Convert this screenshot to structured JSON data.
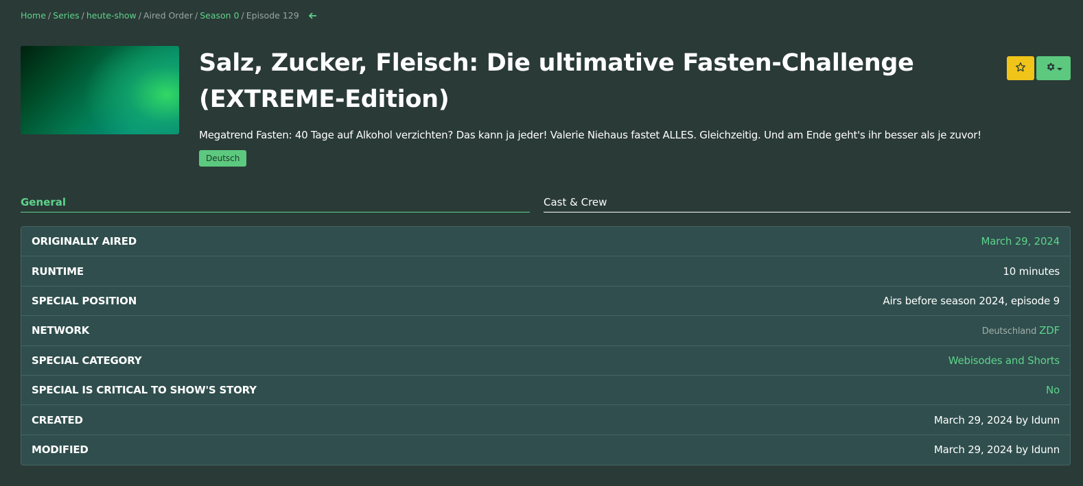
{
  "breadcrumb": {
    "home": "Home",
    "series": "Series",
    "show": "heute-show",
    "order": "Aired Order",
    "season": "Season 0",
    "episode": "Episode 129",
    "separator": "/",
    "back_icon": "arrow-left-icon"
  },
  "episode": {
    "title": "Salz, Zucker, Fleisch: Die ultimative Fasten-Challenge (EXTREME-Edition)",
    "overview": "Megatrend Fasten: 40 Tage auf Alkohol verzichten? Das kann ja jeder! Valerie Niehaus fastet ALLES. Gleichzeitig. Und am Ende geht's ihr besser als je zuvor!",
    "language": "Deutsch"
  },
  "actions": {
    "favorite_icon": "star-icon",
    "settings_icon": "gear-icon",
    "caret_icon": "caret-down-icon"
  },
  "tabs": {
    "general": "General",
    "cast": "Cast & Crew"
  },
  "info": {
    "originally_aired_label": "ORIGINALLY AIRED",
    "originally_aired_value": "March 29, 2024",
    "runtime_label": "RUNTIME",
    "runtime_value": "10 minutes",
    "special_position_label": "SPECIAL POSITION",
    "special_position_value": "Airs before season 2024, episode 9",
    "network_label": "NETWORK",
    "network_country": "Deutschland",
    "network_value": "ZDF",
    "special_category_label": "SPECIAL CATEGORY",
    "special_category_value": "Webisodes and Shorts",
    "critical_label": "SPECIAL IS CRITICAL TO SHOW'S STORY",
    "critical_value": "No",
    "created_label": "CREATED",
    "created_value": "March 29, 2024 by Idunn",
    "modified_label": "MODIFIED",
    "modified_value": "March 29, 2024 by Idunn"
  },
  "colors": {
    "background": "#2a3a37",
    "accent": "#5fd38b",
    "favorite": "#f0c419",
    "table_bg": "#2f4e4d"
  }
}
